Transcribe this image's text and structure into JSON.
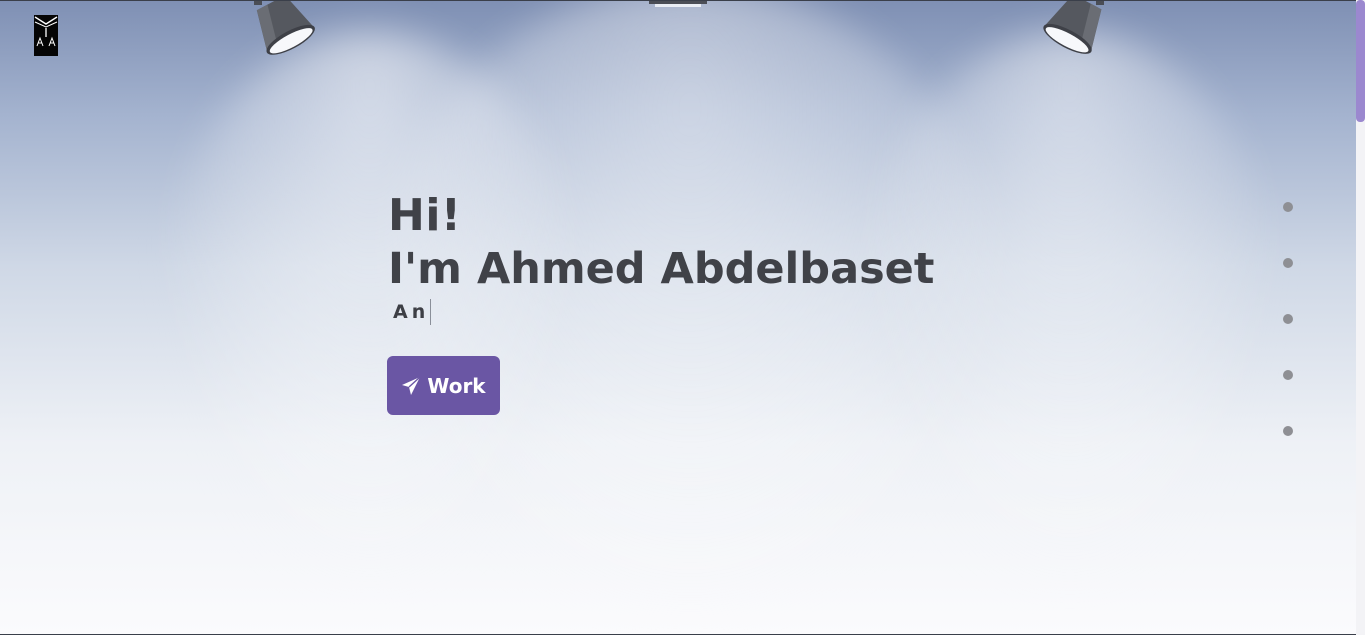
{
  "logo": {
    "icon": "initials-logo-icon",
    "letters": [
      "A",
      "A"
    ]
  },
  "hero": {
    "greeting": "Hi!",
    "name": "I'm Ahmed Abdelbaset",
    "typed_text": "An"
  },
  "cta": {
    "label": "Work",
    "icon": "paper-plane-icon"
  },
  "section_nav": {
    "dot_count": 5
  },
  "colors": {
    "accent": "#6a56a4",
    "text": "#404248",
    "dot": "#8e8f94",
    "scroll_thumb": "#9b88cf"
  }
}
